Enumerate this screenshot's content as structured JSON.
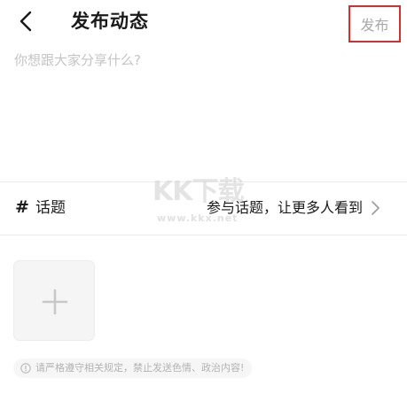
{
  "header": {
    "back_icon": "chevron-left-icon",
    "title": "发布动态",
    "publish_label": "发布",
    "publish_highlight_color": "#d32f2f"
  },
  "composer": {
    "placeholder": "你想跟大家分享什么?",
    "value": ""
  },
  "topic": {
    "icon": "hash-icon",
    "icon_glyph": "#",
    "label": "话题",
    "hint": "参与话题，让更多人看到",
    "chevron_icon": "chevron-right-icon"
  },
  "media": {
    "add_icon": "plus-icon"
  },
  "notice": {
    "icon": "info-icon",
    "text": "请严格遵守相关规定，禁止发送色情、政治内容!"
  },
  "watermark": {
    "mark": "KK下载",
    "url": "www.kkx.net"
  }
}
